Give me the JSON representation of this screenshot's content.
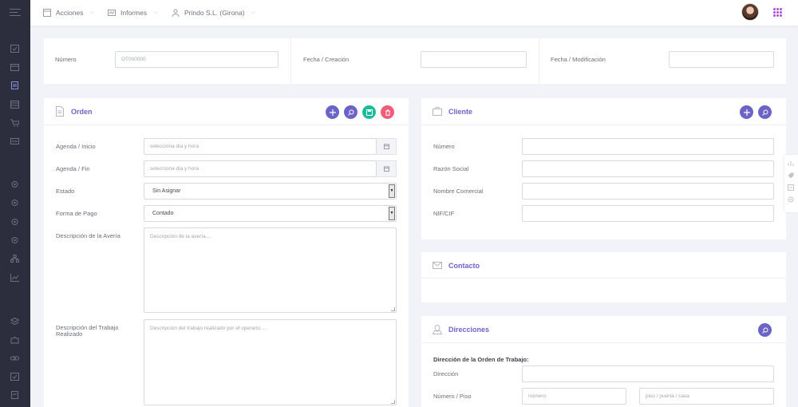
{
  "header": {
    "menu": [
      {
        "label": "Acciones"
      },
      {
        "label": "Informes"
      },
      {
        "label": "Prindo S.L. (Girona)"
      }
    ]
  },
  "top_form": {
    "numero_label": "Número",
    "numero_placeholder": "OT000000",
    "fecha_creacion_label": "Fecha / Creación",
    "fecha_modificacion_label": "Fecha / Modificación"
  },
  "orden": {
    "title": "Orden",
    "agenda_inicio_label": "Agenda / Inicio",
    "agenda_inicio_placeholder": "selecciona dia y hora",
    "agenda_fin_label": "Agenda / Fin",
    "agenda_fin_placeholder": "selecciona dia y hora",
    "estado_label": "Estado",
    "estado_value": "Sin Asignar",
    "forma_pago_label": "Forma de Pago",
    "forma_pago_value": "Contado",
    "descripcion_averia_label": "Descripción de la Avería",
    "descripcion_averia_placeholder": "Descripción de la avería ...",
    "descripcion_trabajo_label_1": "Descripción del Trabajo",
    "descripcion_trabajo_label_2": "Realizado",
    "descripcion_trabajo_placeholder": "Descripción del trabajo realizado por el operario ..."
  },
  "cliente": {
    "title": "Cliente",
    "numero_label": "Número",
    "razon_social_label": "Razón Social",
    "nombre_comercial_label": "Nombre Comercial",
    "nif_label": "NIF/CIF"
  },
  "contacto": {
    "title": "Contacto"
  },
  "direcciones": {
    "title": "Direcciones",
    "subheading": "Dirección de la Orden de Trabajo:",
    "direccion_label": "Dirección",
    "numero_piso_label": "Número / Piso",
    "numero_placeholder": "número",
    "piso_placeholder": "piso / puerta / casa"
  },
  "colors": {
    "accent_purple": "#6c63c7",
    "button_green": "#1abc9c",
    "button_red": "#f25c7a",
    "sidebar": "#2c2e3e"
  }
}
